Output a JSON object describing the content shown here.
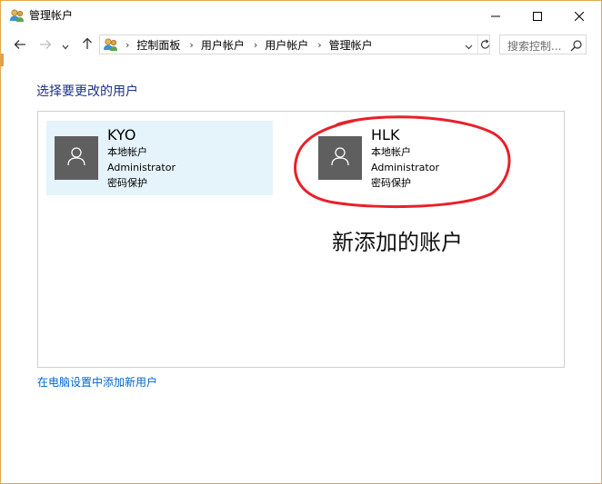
{
  "window": {
    "title": "管理帐户",
    "buttons": {
      "minimize_icon": "minimize-icon",
      "maximize_icon": "maximize-icon",
      "close_icon": "close-icon"
    },
    "border_color": "#e3a84a"
  },
  "nav": {
    "back_icon": "arrow-left-icon",
    "forward_icon": "arrow-right-icon",
    "recent_icon": "chevron-down-icon",
    "up_icon": "arrow-up-icon",
    "breadcrumbs": [
      "控制面板",
      "用户帐户",
      "用户帐户",
      "管理帐户"
    ],
    "refresh_icon": "refresh-icon",
    "search_placeholder": "搜索控制..."
  },
  "main": {
    "heading": "选择要更改的用户",
    "heading_color": "#1e3287",
    "users": [
      {
        "name": "KYO",
        "type": "本地帐户",
        "role": "Administrator",
        "protection": "密码保护",
        "selected": true
      },
      {
        "name": "HLK",
        "type": "本地帐户",
        "role": "Administrator",
        "protection": "密码保护",
        "selected": false
      }
    ],
    "annotation": "新添加的账户",
    "annotation_color": "#e8202a",
    "add_user_link": "在电脑设置中添加新用户",
    "link_color": "#0066cc"
  }
}
